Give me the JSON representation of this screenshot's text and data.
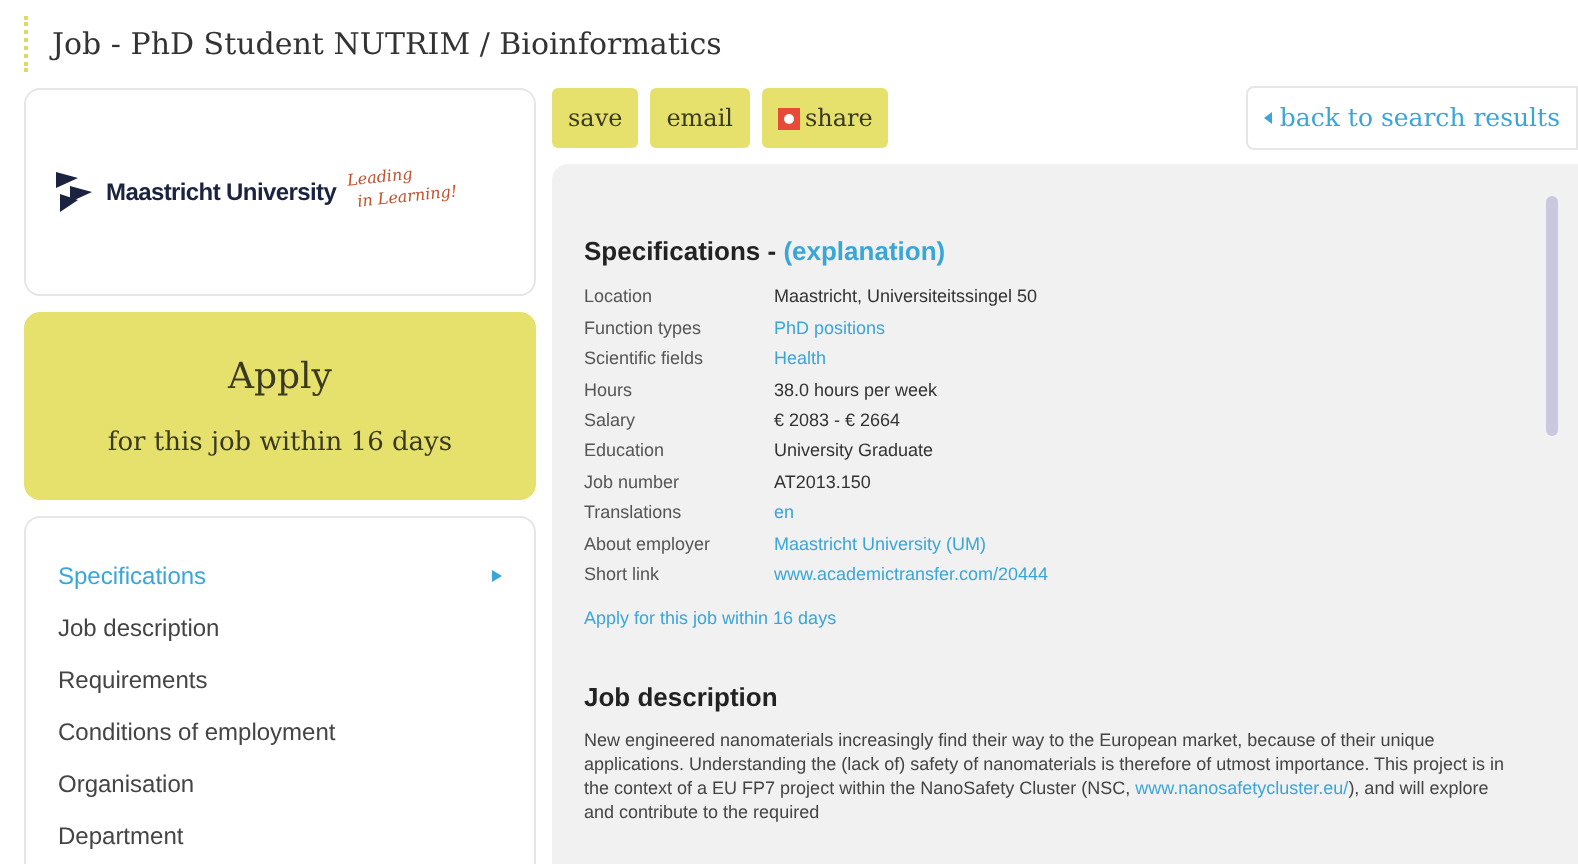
{
  "page_title": "Job - PhD Student NUTRIM / Bioinformatics",
  "logo": {
    "name": "Maastricht University",
    "slogan_1": "Leading",
    "slogan_2": "in Learning!"
  },
  "apply": {
    "title": "Apply",
    "subtitle": "for this job within 16 days"
  },
  "nav": [
    {
      "label": "Specifications",
      "selected": true
    },
    {
      "label": "Job description",
      "selected": false
    },
    {
      "label": "Requirements",
      "selected": false
    },
    {
      "label": "Conditions of employment",
      "selected": false
    },
    {
      "label": "Organisation",
      "selected": false
    },
    {
      "label": "Department",
      "selected": false
    }
  ],
  "actions": [
    {
      "label": "save",
      "kind": "plain"
    },
    {
      "label": "email",
      "kind": "plain"
    },
    {
      "label": "share",
      "kind": "share"
    }
  ],
  "back_link": "back to search results",
  "specifications": {
    "title": "Specifications - ",
    "explanation": "(explanation)",
    "rows": [
      {
        "label": "Location",
        "value": "Maastricht, Universiteitssingel 50",
        "kind": "text"
      },
      {
        "label": "Function types",
        "value": "PhD positions",
        "kind": "link"
      },
      {
        "label": "Scientific fields",
        "value": "Health",
        "kind": "link"
      },
      {
        "label": "Hours",
        "value": "38.0 hours per week",
        "kind": "text"
      },
      {
        "label": "Salary",
        "value": "€ 2083 - € 2664",
        "kind": "text"
      },
      {
        "label": "Education",
        "value": "University Graduate",
        "kind": "text"
      },
      {
        "label": "Job number",
        "value": "AT2013.150",
        "kind": "text"
      },
      {
        "label": "Translations",
        "value": "en",
        "kind": "link"
      },
      {
        "label": "About employer",
        "value": "Maastricht University (UM)",
        "kind": "link"
      },
      {
        "label": "Short link",
        "value": "www.academictransfer.com/20444",
        "kind": "link"
      }
    ],
    "apply_link": "Apply for this job within 16 days"
  },
  "job_description": {
    "title": "Job description",
    "text_before": "New engineered nanomaterials increasingly find their way to the European market, because of their unique applications. Understanding the (lack of) safety of nanomaterials is therefore of utmost importance. This project is in the context of a EU FP7 project within the NanoSafety Cluster (NSC, ",
    "link": "www.nanosafetycluster.eu/",
    "text_after": "), and will explore and contribute to the required"
  }
}
